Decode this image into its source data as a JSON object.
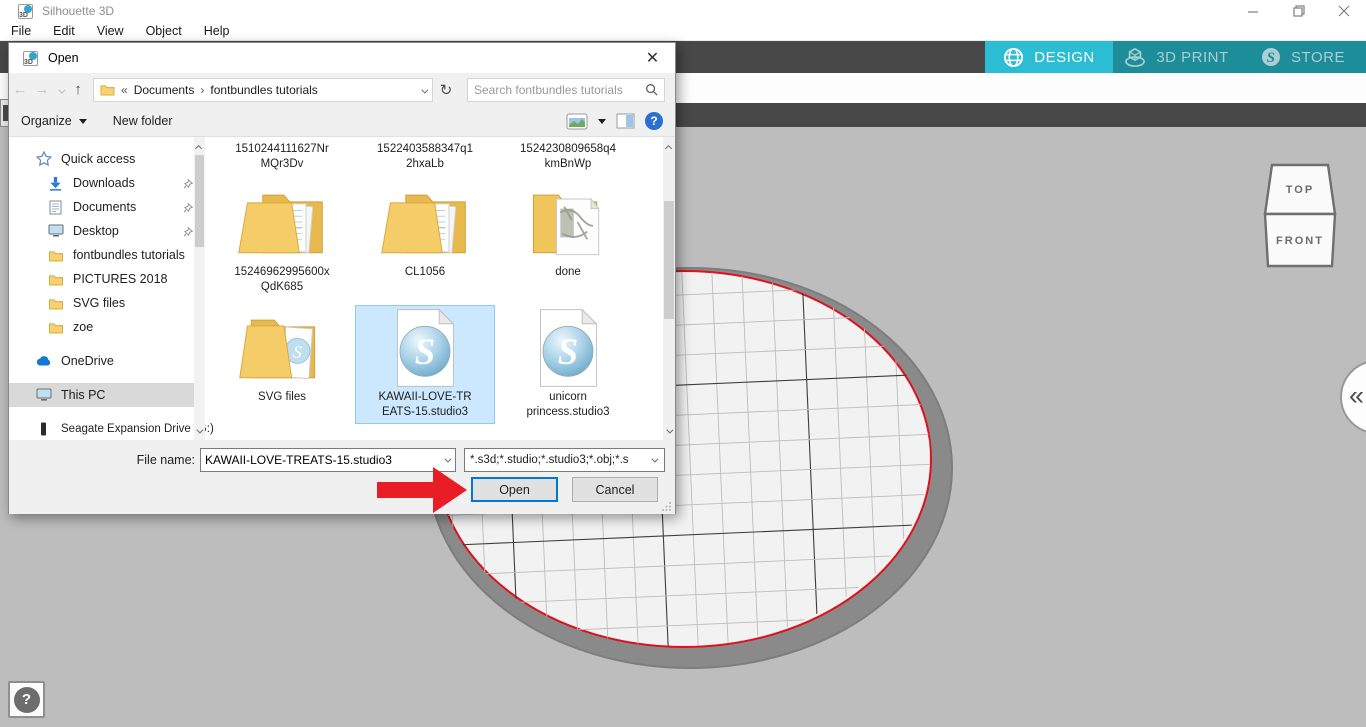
{
  "window": {
    "title": "Silhouette 3D"
  },
  "menu": {
    "items": [
      "File",
      "Edit",
      "View",
      "Object",
      "Help"
    ]
  },
  "tabs": {
    "design": "DESIGN",
    "print": "3D PRINT",
    "store": "STORE"
  },
  "dialog": {
    "title": "Open",
    "breadcrumb": {
      "chevrons": "«",
      "root": "Documents",
      "sep": "›",
      "current": "fontbundles tutorials"
    },
    "search_placeholder": "Search fontbundles tutorials",
    "toolbar": {
      "organize": "Organize",
      "new_folder": "New folder",
      "help": "?"
    },
    "sidebar": {
      "items": [
        {
          "label": "Quick access"
        },
        {
          "label": "Downloads",
          "pinned": true
        },
        {
          "label": "Documents",
          "pinned": true
        },
        {
          "label": "Desktop",
          "pinned": true
        },
        {
          "label": "fontbundles tutorials"
        },
        {
          "label": "PICTURES 2018"
        },
        {
          "label": "SVG files"
        },
        {
          "label": "zoe"
        },
        {
          "label": "OneDrive"
        },
        {
          "label": "This PC",
          "selected": true
        },
        {
          "label": "Seagate Expansion Drive (G:)"
        }
      ]
    },
    "files": {
      "clipped": [
        {
          "name": "1510244111627NrMQr3Dv",
          "display": "1510244111627Nr\nMQr3Dv"
        },
        {
          "name": "1522403588347q12hxaLb",
          "display": "1522403588347q1\n2hxaLb"
        },
        {
          "name": "1524230809658q4kmBnWp",
          "display": "1524230809658q4\nkmBnWp"
        }
      ],
      "row1": [
        {
          "name": "15246962995600xQdK685",
          "display": "15246962995600x\nQdK685",
          "type": "folder"
        },
        {
          "name": "CL1056",
          "display": "CL1056",
          "type": "folder"
        },
        {
          "name": "done",
          "display": "done",
          "type": "folder-photo"
        }
      ],
      "row2": [
        {
          "name": "SVG files",
          "display": "SVG files",
          "type": "folder-pages"
        },
        {
          "name": "KAWAII-LOVE-TREATS-15.studio3",
          "display": "KAWAII-LOVE-TR\nEATS-15.studio3",
          "type": "studio3",
          "selected": true
        },
        {
          "name": "unicorn princess.studio3",
          "display": "unicorn\nprincess.studio3",
          "type": "studio3"
        }
      ]
    },
    "footer": {
      "file_name_label": "File name:",
      "file_name_value": "KAWAII-LOVE-TREATS-15.studio3",
      "file_type_value": "*.s3d;*.studio;*.studio3;*.obj;*.s",
      "open": "Open",
      "cancel": "Cancel"
    }
  },
  "canvas": {
    "cube_top": "TOP",
    "cube_front": "FRONT",
    "expander": "«",
    "help": "?"
  },
  "colors": {
    "tab_active": "#2bbdd3",
    "tab_inactive": "#1e8d9a",
    "toolbar_dark": "#484848",
    "canvas_gray": "#bdbdbd",
    "bed_rim": "#8a8a8a",
    "bed_surface": "#f2f2f2",
    "bed_ring_red": "#e0101c",
    "selection_blue": "#cce8ff",
    "open_button_border": "#0078d7",
    "arrow_red": "#e81d25"
  }
}
